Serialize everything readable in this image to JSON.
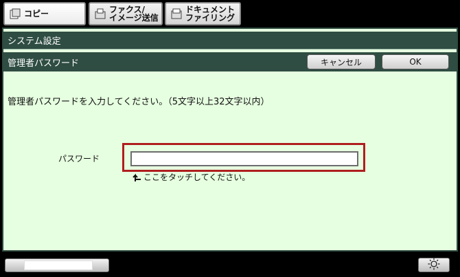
{
  "tabs": [
    {
      "label_line1": "コピー",
      "label_line2": "",
      "icon": "copy-icon",
      "active": true
    },
    {
      "label_line1": "ファクス/",
      "label_line2": "イメージ送信",
      "icon": "fax-icon",
      "active": false
    },
    {
      "label_line1": "ドキュメント",
      "label_line2": "ファイリング",
      "icon": "document-filing-icon",
      "active": false
    }
  ],
  "header": {
    "section_title": "システム設定",
    "dialog_title": "管理者パスワード",
    "cancel_label": "キャンセル",
    "ok_label": "OK"
  },
  "body": {
    "instruction": "管理者パスワードを入力してください。（5文字以上32文字以内）",
    "password_label": "パスワード",
    "password_value": "",
    "hint": "ここをタッチしてください。",
    "hint_icon": "touch-arrow-icon"
  },
  "footer": {
    "brightness_icon": "brightness-icon"
  },
  "colors": {
    "header_bar": "#2f4d42",
    "panel_bg": "#e6ffe0",
    "highlight_border": "#b01e1e"
  }
}
